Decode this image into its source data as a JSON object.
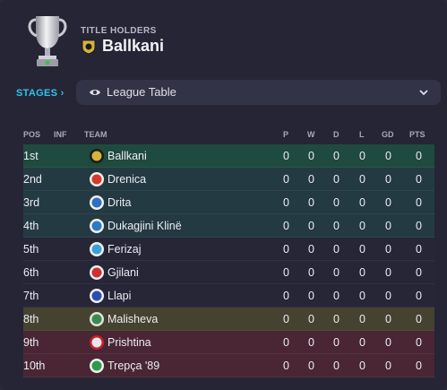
{
  "header": {
    "label": "TITLE HOLDERS",
    "team": "Ballkani"
  },
  "stages": {
    "label": "STAGES ›",
    "selected": "League Table"
  },
  "table": {
    "columns": {
      "pos": "POS",
      "inf": "INF",
      "team": "TEAM",
      "p": "P",
      "w": "W",
      "d": "D",
      "l": "L",
      "gd": "GD",
      "pts": "PTS"
    },
    "rows": [
      {
        "pos": "1st",
        "team": "Ballkani",
        "p": "0",
        "w": "0",
        "d": "0",
        "l": "0",
        "gd": "0",
        "pts": "0",
        "zone": "#1f4a3e",
        "badge": "#d8b33a",
        "badge2": "#1a1a1a"
      },
      {
        "pos": "2nd",
        "team": "Drenica",
        "p": "0",
        "w": "0",
        "d": "0",
        "l": "0",
        "gd": "0",
        "pts": "0",
        "zone": "#243a42",
        "badge": "#d43a2a",
        "badge2": "#f0f0f0"
      },
      {
        "pos": "3rd",
        "team": "Drita",
        "p": "0",
        "w": "0",
        "d": "0",
        "l": "0",
        "gd": "0",
        "pts": "0",
        "zone": "#243a42",
        "badge": "#2c6fc4",
        "badge2": "#f0f0f0"
      },
      {
        "pos": "4th",
        "team": "Dukagjini Klinë",
        "p": "0",
        "w": "0",
        "d": "0",
        "l": "0",
        "gd": "0",
        "pts": "0",
        "zone": "#243a42",
        "badge": "#2a7ac8",
        "badge2": "#f0f0f0"
      },
      {
        "pos": "5th",
        "team": "Ferizaj",
        "p": "0",
        "w": "0",
        "d": "0",
        "l": "0",
        "gd": "0",
        "pts": "0",
        "zone": "#262637",
        "badge": "#3ca0d8",
        "badge2": "#f0f0f0"
      },
      {
        "pos": "6th",
        "team": "Gjilani",
        "p": "0",
        "w": "0",
        "d": "0",
        "l": "0",
        "gd": "0",
        "pts": "0",
        "zone": "#262637",
        "badge": "#d22e2e",
        "badge2": "#f0f0f0"
      },
      {
        "pos": "7th",
        "team": "Llapi",
        "p": "0",
        "w": "0",
        "d": "0",
        "l": "0",
        "gd": "0",
        "pts": "0",
        "zone": "#262637",
        "badge": "#2a4fb0",
        "badge2": "#f0f0f0"
      },
      {
        "pos": "8th",
        "team": "Malisheva",
        "p": "0",
        "w": "0",
        "d": "0",
        "l": "0",
        "gd": "0",
        "pts": "0",
        "zone": "#45432f",
        "badge": "#3a8a4a",
        "badge2": "#e0e0e0"
      },
      {
        "pos": "9th",
        "team": "Prishtina",
        "p": "0",
        "w": "0",
        "d": "0",
        "l": "0",
        "gd": "0",
        "pts": "0",
        "zone": "#4a2634",
        "badge": "#e8e8e8",
        "badge2": "#c8202c"
      },
      {
        "pos": "10th",
        "team": "Trepça '89",
        "p": "0",
        "w": "0",
        "d": "0",
        "l": "0",
        "gd": "0",
        "pts": "0",
        "zone": "#4a2634",
        "badge": "#2f9a4a",
        "badge2": "#f0f0f0"
      }
    ]
  },
  "colors": {
    "accent": "#2fc4e8",
    "panel": "#252536"
  }
}
